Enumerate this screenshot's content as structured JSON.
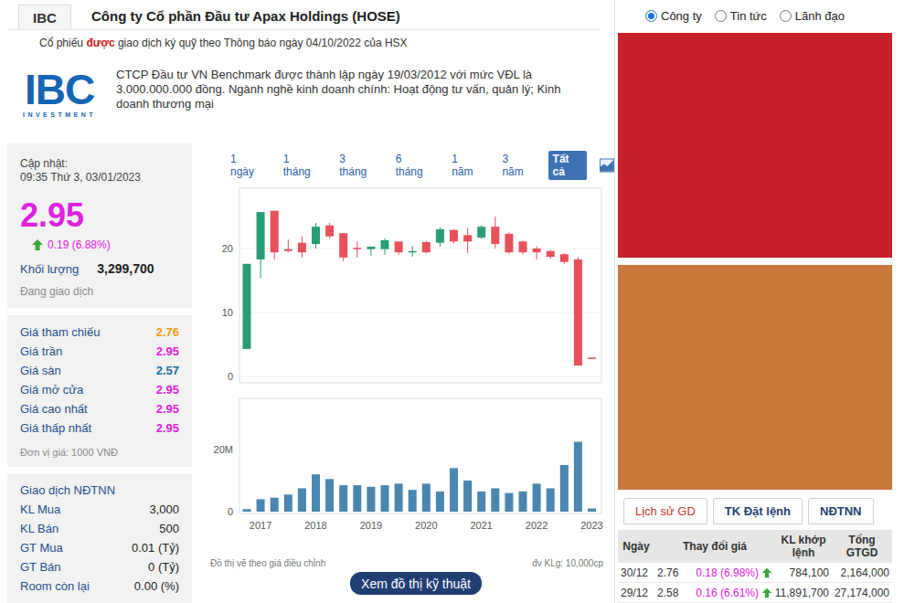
{
  "header": {
    "ticker": "IBC",
    "title": "Công ty Cổ phần Đầu tư Apax Holdings (HOSE)"
  },
  "notice": {
    "before": "Cổ phiếu ",
    "highlight": "được",
    "after": " giao dịch ký quỹ theo Thông báo ngày 04/10/2022 của HSX"
  },
  "company": {
    "logo_text": "IBC",
    "logo_sub": "INVESTMENT",
    "description": "CTCP Đầu tư VN Benchmark được thành lập ngày 19/03/2012 với mức VĐL là 3.000.000.000 đồng. Ngành nghề kinh doanh chính: Hoạt động tư vấn, quản lý; Kinh doanh thương mại"
  },
  "quote": {
    "updated_label": "Cập nhật:",
    "updated_time": "09:35 Thứ 3, 03/01/2023",
    "price": "2.95",
    "change": "0.19 (6.88%)",
    "direction": "up",
    "volume_label": "Khối lượng",
    "volume": "3,299,700",
    "status": "Đang giao dịch"
  },
  "price_rows": [
    {
      "label": "Giá tham chiếu",
      "value": "2.76",
      "color": "#f39c12"
    },
    {
      "label": "Giá trần",
      "value": "2.95",
      "color": "#e020e0"
    },
    {
      "label": "Giá sàn",
      "value": "2.57",
      "color": "#1a6fa5"
    },
    {
      "label": "Giá mở cửa",
      "value": "2.95",
      "color": "#e020e0"
    },
    {
      "label": "Giá cao nhất",
      "value": "2.95",
      "color": "#e020e0"
    },
    {
      "label": "Giá thấp nhất",
      "value": "2.95",
      "color": "#e020e0"
    }
  ],
  "unit_note": "Đơn vị giá: 1000 VNĐ",
  "foreign": {
    "title": "Giao dịch NĐTNN",
    "rows": [
      {
        "label": "KL Mua",
        "value": "3,000"
      },
      {
        "label": "KL Bán",
        "value": "500"
      },
      {
        "label": "GT Mua",
        "value": "0.01 (Tỷ)"
      },
      {
        "label": "GT Bán",
        "value": "0 (Tỷ)"
      },
      {
        "label": "Room còn lại",
        "value": "0.00 (%)"
      }
    ]
  },
  "chart": {
    "ranges": [
      {
        "label": "1 ngày",
        "selected": false
      },
      {
        "label": "1 tháng",
        "selected": false
      },
      {
        "label": "3 tháng",
        "selected": false
      },
      {
        "label": "6 tháng",
        "selected": false
      },
      {
        "label": "1 năm",
        "selected": false
      },
      {
        "label": "3 năm",
        "selected": false
      },
      {
        "label": "Tất cả",
        "selected": true
      }
    ],
    "price_ticks": [
      "20",
      "10",
      "0"
    ],
    "volume_ticks": [
      "20M",
      "0"
    ],
    "years": [
      "2017",
      "2018",
      "2019",
      "2020",
      "2021",
      "2022",
      "2023"
    ],
    "candles": [
      {
        "open": 4.3,
        "close": 17.6,
        "high": 17.6,
        "low": 4.3
      },
      {
        "open": 18.3,
        "close": 25.7,
        "high": 25.7,
        "low": 15.4
      },
      {
        "open": 25.9,
        "close": 19.4,
        "high": 25.9,
        "low": 18.3
      },
      {
        "open": 19.9,
        "close": 19.6,
        "high": 21.4,
        "low": 19.4
      },
      {
        "open": 20.9,
        "close": 19.4,
        "high": 21.9,
        "low": 18.6
      },
      {
        "open": 20.7,
        "close": 23.4,
        "high": 24,
        "low": 20
      },
      {
        "open": 23.6,
        "close": 21.9,
        "high": 24,
        "low": 21.5
      },
      {
        "open": 22.4,
        "close": 18.6,
        "high": 22.4,
        "low": 18
      },
      {
        "open": 20.1,
        "close": 19.9,
        "high": 21.1,
        "low": 18.6
      },
      {
        "open": 19.9,
        "close": 20.3,
        "high": 20.3,
        "low": 18.9
      },
      {
        "open": 19.9,
        "close": 21.3,
        "high": 21.6,
        "low": 19
      },
      {
        "open": 21.1,
        "close": 19.4,
        "high": 21.1,
        "low": 19
      },
      {
        "open": 19.4,
        "close": 19.6,
        "high": 20.4,
        "low": 18.7
      },
      {
        "open": 21,
        "close": 19.4,
        "high": 21.2,
        "low": 19.2
      },
      {
        "open": 20.9,
        "close": 23,
        "high": 23.3,
        "low": 20.3
      },
      {
        "open": 22.9,
        "close": 21.1,
        "high": 23,
        "low": 20.8
      },
      {
        "open": 22.1,
        "close": 21.1,
        "high": 23.2,
        "low": 19.3
      },
      {
        "open": 21.7,
        "close": 23.4,
        "high": 23.6,
        "low": 21.5
      },
      {
        "open": 23.4,
        "close": 20.7,
        "high": 25,
        "low": 20
      },
      {
        "open": 22.3,
        "close": 19.4,
        "high": 22.5,
        "low": 19.2
      },
      {
        "open": 21.1,
        "close": 19.4,
        "high": 21.2,
        "low": 19.1
      },
      {
        "open": 20,
        "close": 19.4,
        "high": 20.4,
        "low": 18.3
      },
      {
        "open": 19.6,
        "close": 18.7,
        "high": 19.8,
        "low": 18.4
      },
      {
        "open": 19.1,
        "close": 17.9,
        "high": 19.3,
        "low": 17.6
      },
      {
        "open": 18.3,
        "close": 1.7,
        "high": 18.6,
        "low": 1.7
      },
      {
        "open": 2.95,
        "close": 2.9,
        "high": 2.95,
        "low": 2.9
      }
    ],
    "volume": [
      0.8,
      4,
      4.5,
      5.5,
      7.5,
      12,
      10.5,
      8.5,
      8.5,
      8,
      8.5,
      9,
      7,
      9,
      6.5,
      14,
      10,
      6.5,
      7.5,
      6,
      6.5,
      9,
      7.5,
      15,
      22.5,
      1
    ],
    "note": "Đồ thị vẽ theo giá điều chỉnh",
    "unit": "đv KLg: 10,000cp",
    "button": "Xem đồ thị kỹ thuật"
  },
  "sidebar": {
    "radios": [
      {
        "label": "Công ty",
        "selected": true
      },
      {
        "label": "Tin tức",
        "selected": false
      },
      {
        "label": "Lãnh đạo",
        "selected": false
      }
    ],
    "ads": [
      {
        "color": "#c8202c"
      },
      {
        "color": "#c9773a"
      }
    ],
    "tabs": [
      {
        "label": "Lịch sử GD",
        "selected": true
      },
      {
        "label": "TK Đặt lệnh",
        "selected": false
      },
      {
        "label": "NĐTNN",
        "selected": false
      }
    ],
    "table": {
      "columns": [
        "Ngày",
        "Thay đổi giá",
        "KL khớp lệnh",
        "Tổng GTGD"
      ],
      "rows": [
        {
          "date": "30/12",
          "price": "2.76",
          "change": "0.18 (6.98%)",
          "direction": "up",
          "volume": "784,100",
          "value": "2,164,000"
        },
        {
          "date": "29/12",
          "price": "2.58",
          "change": "0.16 (6.61%)",
          "direction": "up",
          "volume": "11,891,700",
          "value": "27,174,000"
        }
      ]
    }
  }
}
